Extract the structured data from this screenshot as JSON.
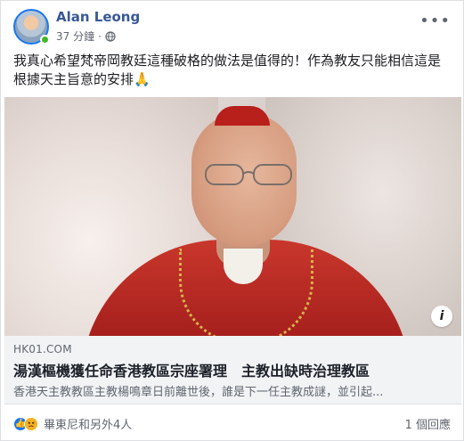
{
  "post": {
    "author": "Alan Leong",
    "time": "37 分鐘",
    "separator": "·",
    "text": "我真心希望梵帝岡教廷這種破格的做法是值得的！作為教友只能相信這是根據天主旨意的安排🙏"
  },
  "link": {
    "domain": "HK01.COM",
    "headline": "湯漢樞機獲任命香港教區宗座署理　主教出缺時治理教區",
    "description": "香港天主教教區主教楊鳴章日前離世後，誰是下一任主教成謎，並引起..."
  },
  "footer": {
    "reactions_text": "畢東尼和另外4人",
    "comments_text": "1 個回應"
  },
  "icons": {
    "more": "more-options-icon",
    "globe": "globe-icon",
    "info": "info-icon",
    "like": "like-reaction-icon",
    "angry": "angry-reaction-icon"
  },
  "colors": {
    "author": "#385898",
    "like": "#1877f2",
    "angry": "#f7b125"
  }
}
